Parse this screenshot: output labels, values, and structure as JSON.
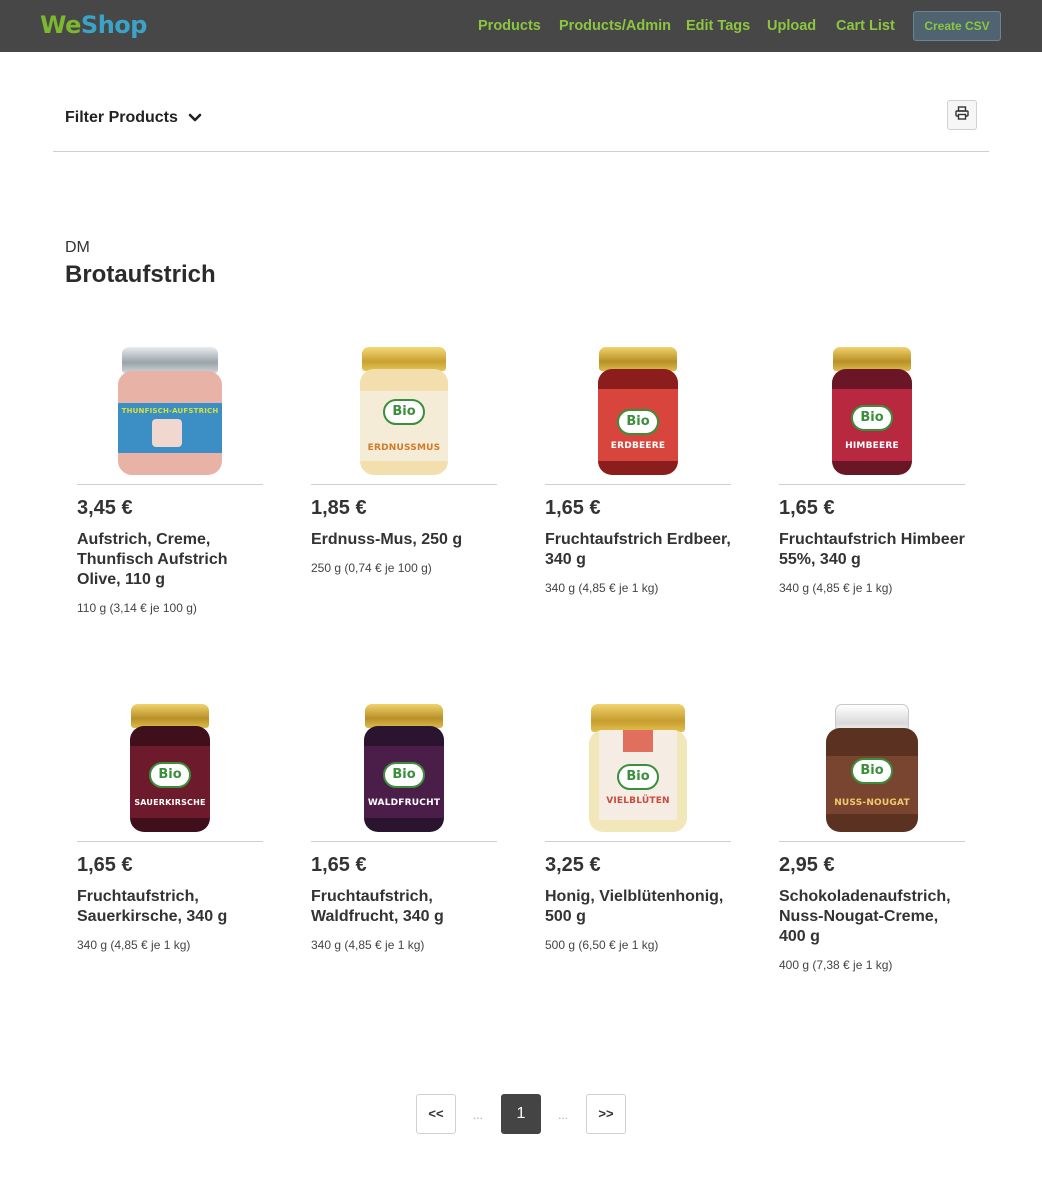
{
  "navbar": {
    "brand_we": "We",
    "brand_shop": "Shop",
    "links": [
      "Products",
      "Products/Admin",
      "Edit Tags",
      "Upload",
      "Cart List"
    ],
    "create_csv": "Create CSV"
  },
  "filter": {
    "label": "Filter Products"
  },
  "section": {
    "shop": "DM",
    "category": "Brotaufstrich"
  },
  "products": [
    {
      "price": "3,45 €",
      "name": "Aufstrich, Creme, Thunfisch Aufstrich Olive, 110 g",
      "unit": "110 g (3,14 € je 100 g)",
      "jar_label": "THUNFISCH-AUFSTRICH"
    },
    {
      "price": "1,85 €",
      "name": "Erdnuss-Mus, 250 g",
      "unit": "250 g (0,74 € je 100 g)",
      "jar_label": "ERDNUSSMUS"
    },
    {
      "price": "1,65 €",
      "name": "Fruchtaufstrich Erdbeer, 340 g",
      "unit": "340 g (4,85 € je 1 kg)",
      "jar_label": "ERDBEERE"
    },
    {
      "price": "1,65 €",
      "name": "Fruchtaufstrich Himbeer 55%, 340 g",
      "unit": "340 g (4,85 € je 1 kg)",
      "jar_label": "HIMBEERE"
    },
    {
      "price": "1,65 €",
      "name": "Fruchtaufstrich, Sauerkirsche, 340 g",
      "unit": "340 g (4,85 € je 1 kg)",
      "jar_label": "SAUERKIRSCHE"
    },
    {
      "price": "1,65 €",
      "name": "Fruchtaufstrich, Waldfrucht, 340 g",
      "unit": "340 g (4,85 € je 1 kg)",
      "jar_label": "WALDFRUCHT"
    },
    {
      "price": "3,25 €",
      "name": "Honig, Vielblütenhonig, 500 g",
      "unit": "500 g (6,50 € je 1 kg)",
      "jar_label": "VIELBLÜTEN"
    },
    {
      "price": "2,95 €",
      "name": "Schokoladenaufstrich, Nuss-Nougat-Creme, 400 g",
      "unit": "400 g (7,38 € je 1 kg)",
      "jar_label": "NUSS-NOUGAT"
    }
  ],
  "jar_badge": "Bio",
  "pagination": {
    "first": "<<",
    "dots_left": "...",
    "current": "1",
    "dots_right": "...",
    "last": ">>"
  },
  "icons": {
    "filter_chevron": "chevron-down-icon",
    "print": "print-icon"
  },
  "colors": {
    "navbar_bg": "#474747",
    "nav_link": "#8cc63f",
    "brand_we": "#7cb82f",
    "brand_shop": "#3aa3c8",
    "active_page": "#444444"
  }
}
